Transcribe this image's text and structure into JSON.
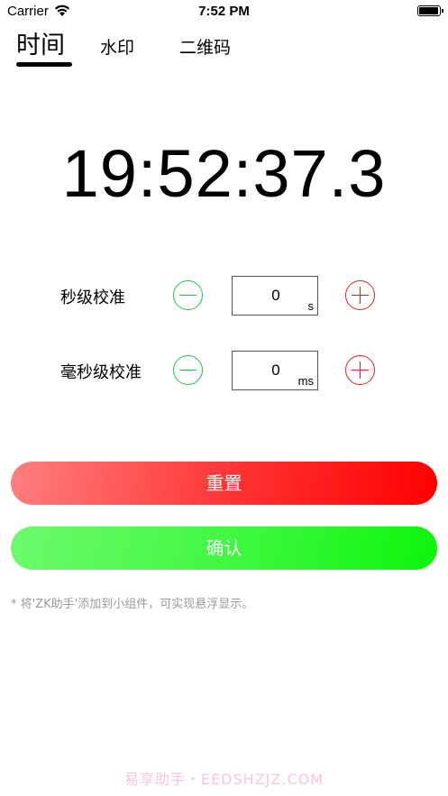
{
  "status_bar": {
    "carrier": "Carrier",
    "time": "7:52 PM",
    "battery_level": 0.95
  },
  "tabs": [
    {
      "label": "时间",
      "active": true
    },
    {
      "label": "水印",
      "active": false
    },
    {
      "label": "二维码",
      "active": false
    }
  ],
  "time_display": "19:52:37.3",
  "calibration": {
    "seconds": {
      "label": "秒级校准",
      "value": "0",
      "unit": "s"
    },
    "milliseconds": {
      "label": "毫秒级校准",
      "value": "0",
      "unit": "ms"
    }
  },
  "buttons": {
    "reset": "重置",
    "confirm": "确认"
  },
  "hint": "* 将'ZK助手'添加到小组件，可实现悬浮显示。",
  "watermark": "易享助手・EEDSHZJZ.COM",
  "colors": {
    "minus_green": "#22c44a",
    "plus_red": "#e02020",
    "reset_gradient": [
      "#ff7f7f",
      "#ff0000"
    ],
    "confirm_gradient": [
      "#6dfa6d",
      "#0cf50c"
    ],
    "hint_gray": "#9a9a9a"
  },
  "icons": {
    "wifi": "wifi-icon",
    "battery": "battery-icon",
    "minus": "minus-circle-icon",
    "plus": "plus-circle-icon"
  }
}
